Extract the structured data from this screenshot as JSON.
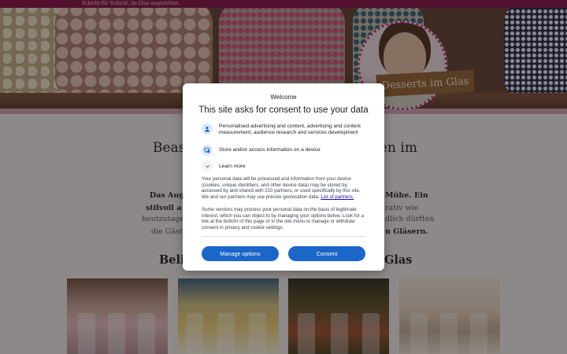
{
  "site": {
    "tagline": "Schicht für Schicht, im Glas angerichtet.",
    "logo_text": "Desserts im Glas",
    "heading_left": "Beas",
    "heading_right": "en im",
    "paragraph_left": [
      {
        "text": "Das Auge i",
        "bold": true
      },
      {
        "text": "stilvoll a",
        "bold": true
      },
      {
        "text": "heutzutage e",
        "bold": false
      },
      {
        "text": "die Gäste s",
        "bold": false
      }
    ],
    "paragraph_right": [
      {
        "text": "Mühe. Ein",
        "bold": true
      },
      {
        "text": "rativ wie",
        "bold": false
      },
      {
        "text": "dlich dürften",
        "bold": false
      },
      {
        "text": "n Gläsern.",
        "bold": true
      }
    ],
    "subheading_left": "Belie",
    "subheading_right": "Glas",
    "thumbnails": [
      "dessert-photo",
      "dessert-photo",
      "dessert-photo",
      "dessert-photo"
    ]
  },
  "consent": {
    "welcome": "Welcome",
    "title": "This site asks for consent to use your data",
    "purposes": [
      {
        "icon": "person-icon",
        "text": "Personalised advertising and content, advertising and content measurement, audience research and services development"
      },
      {
        "icon": "device-icon",
        "text": "Store and/or access information on a device"
      }
    ],
    "learn_more": "Learn more",
    "description_1": "Your personal data will be processed and information from your device (cookies, unique identifiers, and other device data) may be stored by, accessed by and shared with 210 partners, or used specifically by this site. We and our partners may use precise geolocation data. ",
    "partners_link": "List of partners.",
    "description_2": "Some vendors may process your personal data on the basis of legitimate interest, which you can object to by managing your options below. Look for a link at the bottom of this page or in the site menu to manage or withdraw consent in privacy and cookie settings.",
    "manage_button": "Manage options",
    "consent_button": "Consent",
    "accent_color": "#1a66c9"
  }
}
